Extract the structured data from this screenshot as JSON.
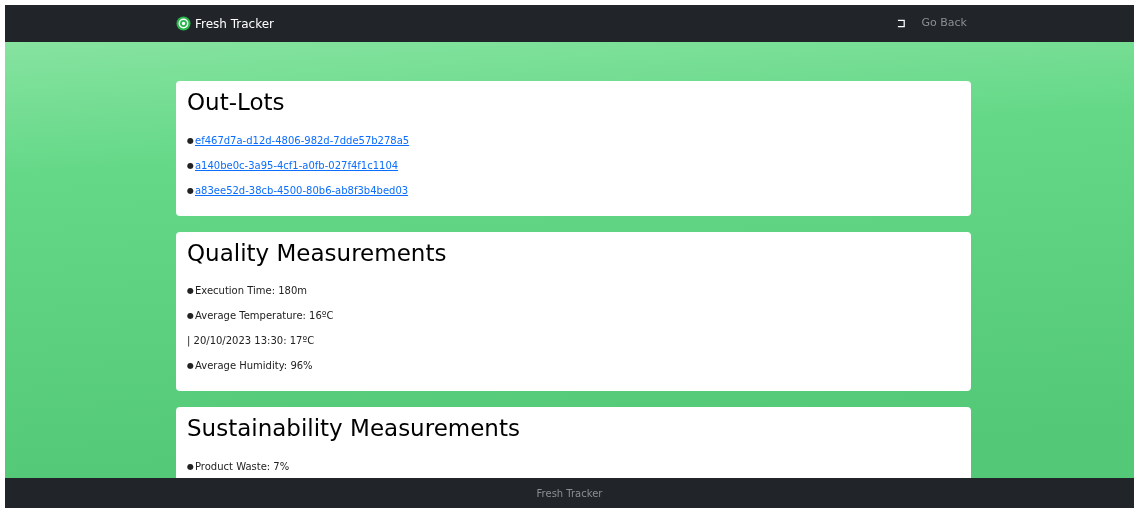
{
  "navbar": {
    "brand": "Fresh Tracker",
    "back_link": "Go Back"
  },
  "sections": [
    {
      "title": "Out-Lots",
      "items": [
        {
          "kind": "link",
          "marker": "●",
          "text": "ef467d7a-d12d-4806-982d-7dde57b278a5"
        },
        {
          "kind": "link",
          "marker": "●",
          "text": "a140be0c-3a95-4cf1-a0fb-027f4f1c1104"
        },
        {
          "kind": "link",
          "marker": "●",
          "text": "a83ee52d-38cb-4500-80b6-ab8f3b4bed03"
        }
      ]
    },
    {
      "title": "Quality Measurements",
      "items": [
        {
          "kind": "text",
          "marker": "●",
          "text": "Execution Time: 180m"
        },
        {
          "kind": "text",
          "marker": "●",
          "text": "Average Temperature: 16ºC"
        },
        {
          "kind": "text",
          "text": "| 20/10/2023 13:30: 17ºC"
        },
        {
          "kind": "text",
          "marker": "●",
          "text": "Average Humidity: 96%"
        }
      ]
    },
    {
      "title": "Sustainability Measurements",
      "items": [
        {
          "kind": "text",
          "marker": "●",
          "text": "Product Waste: 7%"
        }
      ]
    }
  ],
  "footer": "Fresh Tracker"
}
